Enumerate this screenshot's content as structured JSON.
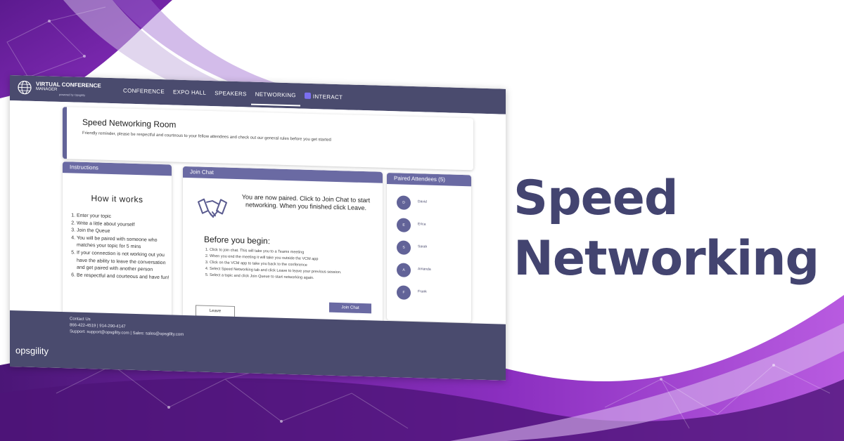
{
  "headline": {
    "line1": "Speed",
    "line2": "Networking"
  },
  "app": {
    "logo": {
      "title": "VIRTUAL CONFERENCE",
      "subtitle": "MANAGER",
      "by": "powered by Opsgility"
    },
    "nav": [
      "CONFERENCE",
      "EXPO HALL",
      "SPEAKERS",
      "NETWORKING",
      "INTERACT"
    ],
    "welcome": {
      "title": "Speed Networking Room",
      "text": "Friendly reminder, please be respectful and courteous to your fellow attendees and check out our general rules before you get started"
    },
    "instructions": {
      "header": "Instructions",
      "title": "How it works",
      "items": [
        "Enter your topic",
        "Write a little about yourself",
        "Join the Queue",
        "You will be paired with someone who matches your topic for 5 mins",
        "If your connection is not working out you have the ability to leave the conversation and get paired with another person",
        "Be respectful and courteous and have fun!"
      ]
    },
    "chat": {
      "header": "Join Chat",
      "message": "You are now paired. Click to Join Chat to start networking. When you finished click Leave.",
      "before_title": "Before you begin:",
      "steps": [
        "Click to join chat. This will take you to a Teams meeting",
        "When you end the meeting it will take you outside the VCM app",
        "Click on the VCM app to take you back to the conference",
        "Select Speed Networking tab and click Leave to leave your previous session.",
        "Select a topic and click Join Queue to start networking again."
      ],
      "leave_label": "Leave",
      "join_label": "Join Chat"
    },
    "paired": {
      "header": "Paired Attendees (5)",
      "attendees": [
        {
          "initial": "D",
          "name": "David"
        },
        {
          "initial": "E",
          "name": "Erica"
        },
        {
          "initial": "S",
          "name": "Sarah"
        },
        {
          "initial": "A",
          "name": "Amanda"
        },
        {
          "initial": "F",
          "name": "Frank"
        }
      ]
    },
    "footer": {
      "brand": "opsgility",
      "contact_title": "Contact Us",
      "phone": "866-422-4519 | 914-290-4147",
      "support": "Support: support@opsgility.com | Sales: sales@opsgility.com"
    }
  }
}
